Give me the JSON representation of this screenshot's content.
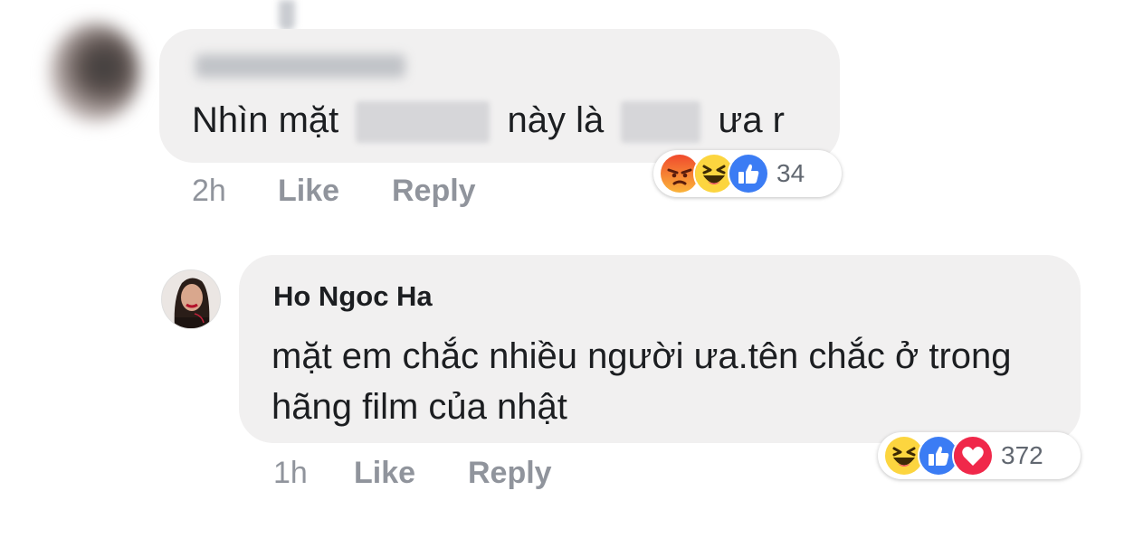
{
  "comments": [
    {
      "text_part1": "Nhìn mặt",
      "text_part2": "này là",
      "text_part3": "ưa r",
      "time": "2h",
      "like_label": "Like",
      "reply_label": "Reply",
      "reactions": [
        "angry-reaction-icon",
        "haha-reaction-icon",
        "like-reaction-icon"
      ],
      "reaction_count": "34"
    },
    {
      "author": "Ho Ngoc Ha",
      "text": "mặt em chắc nhiều người ưa.tên chắc ở trong hãng film của nhật",
      "time": "1h",
      "like_label": "Like",
      "reply_label": "Reply",
      "reactions": [
        "haha-reaction-icon",
        "like-reaction-icon",
        "love-reaction-icon"
      ],
      "reaction_count": "372"
    }
  ],
  "colors": {
    "bubble_bg": "#f1f0f0",
    "meta_text": "#90949c",
    "like_blue": "#3b7cf4",
    "love_red": "#f0284a",
    "angry_orange": "#f26a35",
    "haha_yellow": "#fcd53f"
  }
}
